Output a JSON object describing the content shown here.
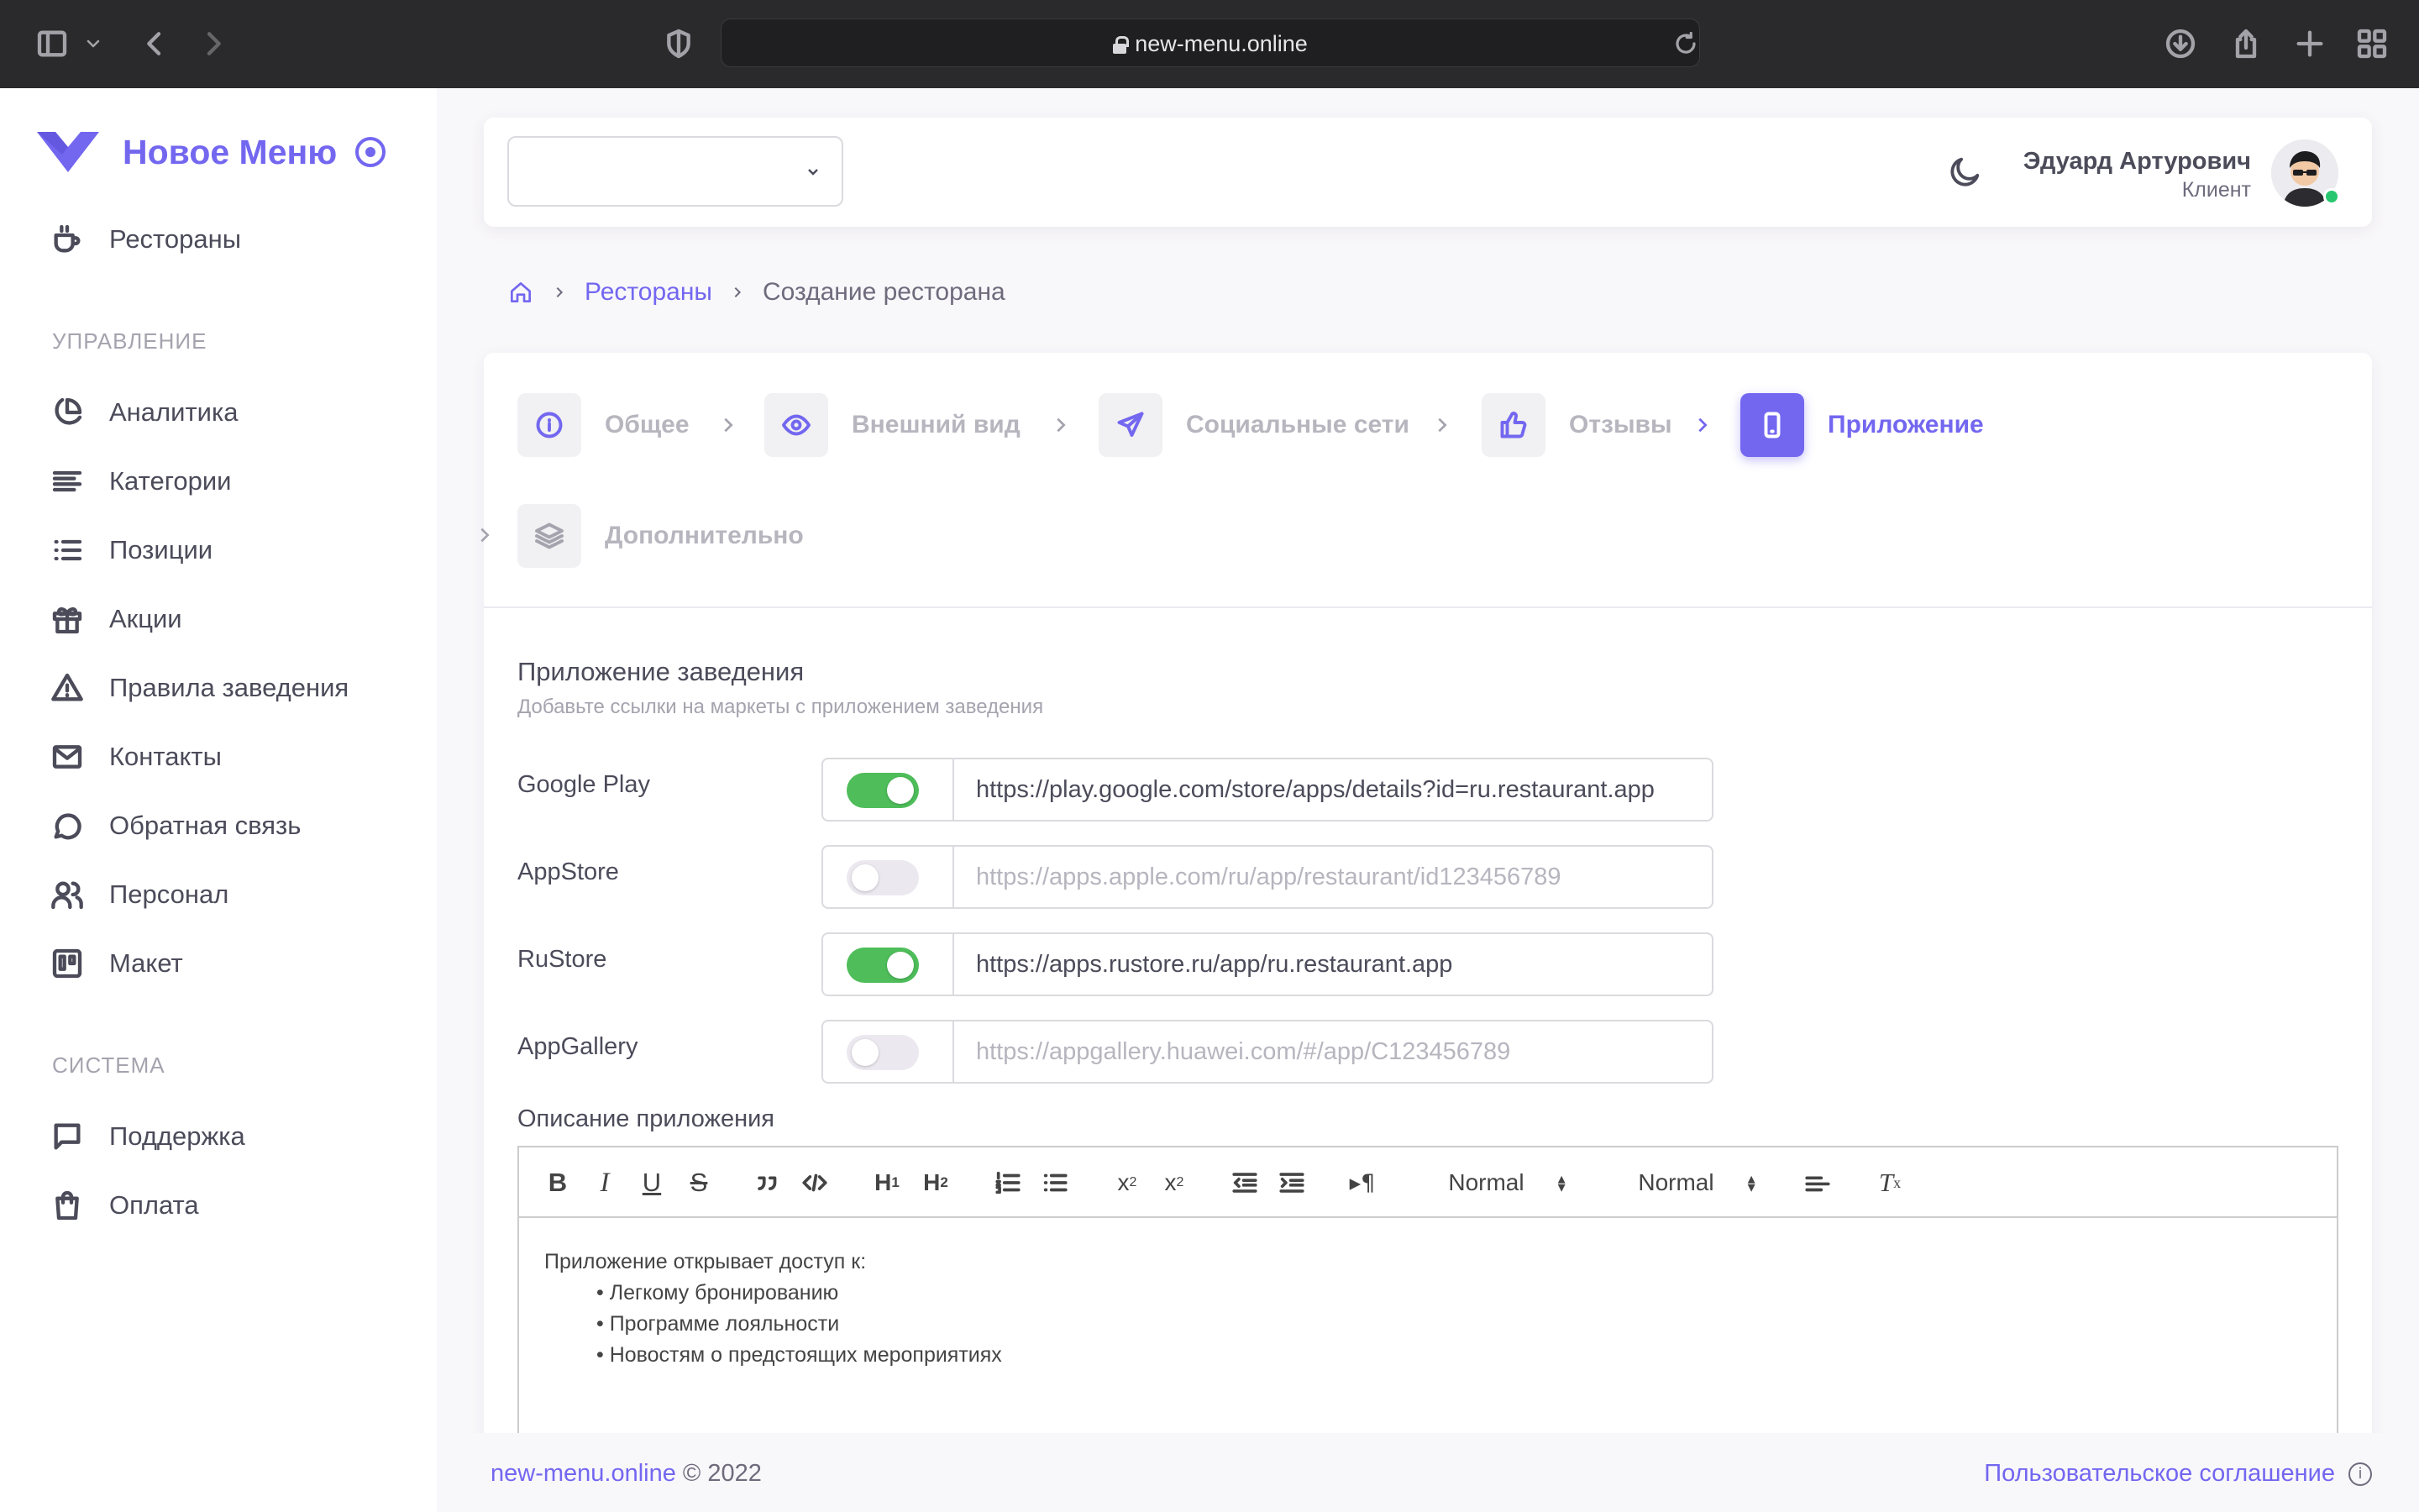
{
  "browser": {
    "url": "new-menu.online"
  },
  "sidebar": {
    "brand": "Новое Меню",
    "top_items": [
      {
        "label": "Рестораны",
        "icon": "coffee-cup-icon"
      }
    ],
    "sections": [
      {
        "title": "УПРАВЛЕНИЕ",
        "items": [
          {
            "label": "Аналитика",
            "icon": "pie-chart-icon"
          },
          {
            "label": "Категории",
            "icon": "align-left-icon"
          },
          {
            "label": "Позиции",
            "icon": "list-icon"
          },
          {
            "label": "Акции",
            "icon": "gift-icon"
          },
          {
            "label": "Правила заведения",
            "icon": "alert-triangle-icon"
          },
          {
            "label": "Контакты",
            "icon": "mail-icon"
          },
          {
            "label": "Обратная связь",
            "icon": "message-circle-icon"
          },
          {
            "label": "Персонал",
            "icon": "users-icon"
          },
          {
            "label": "Макет",
            "icon": "layout-board-icon"
          }
        ]
      },
      {
        "title": "СИСТЕМА",
        "items": [
          {
            "label": "Поддержка",
            "icon": "message-square-icon"
          },
          {
            "label": "Оплата",
            "icon": "shopping-bag-icon"
          }
        ]
      }
    ]
  },
  "header": {
    "select_value": "",
    "user_name": "Эдуард Артурович",
    "user_role": "Клиент"
  },
  "breadcrumb": {
    "link": "Рестораны",
    "current": "Создание ресторана"
  },
  "wizard": {
    "steps": [
      {
        "label": "Общее",
        "icon": "info-icon",
        "state": "done"
      },
      {
        "label": "Внешний вид",
        "icon": "eye-icon",
        "state": "done"
      },
      {
        "label": "Социальные сети",
        "icon": "send-icon",
        "state": "done"
      },
      {
        "label": "Отзывы",
        "icon": "thumbs-up-icon",
        "state": "done"
      },
      {
        "label": "Приложение",
        "icon": "smartphone-icon",
        "state": "active"
      },
      {
        "label": "Дополнительно",
        "icon": "layers-icon",
        "state": "disabled"
      }
    ]
  },
  "app_section": {
    "title": "Приложение заведения",
    "subtitle": "Добавьте ссылки на маркеты с приложением заведения",
    "stores": [
      {
        "label": "Google Play",
        "enabled": true,
        "value": "https://play.google.com/store/apps/details?id=ru.restaurant.app",
        "placeholder": ""
      },
      {
        "label": "AppStore",
        "enabled": false,
        "value": "",
        "placeholder": "https://apps.apple.com/ru/app/restaurant/id123456789"
      },
      {
        "label": "RuStore",
        "enabled": true,
        "value": "https://apps.rustore.ru/app/ru.restaurant.app",
        "placeholder": ""
      },
      {
        "label": "AppGallery",
        "enabled": false,
        "value": "",
        "placeholder": "https://appgallery.huawei.com/#/app/C123456789"
      }
    ],
    "description_label": "Описание приложения",
    "toolbar": {
      "header_select": "Normal",
      "size_select": "Normal"
    },
    "description_text": {
      "intro": "Приложение открывает доступ к:",
      "bullets": [
        "• Легкому бронированию",
        "• Программе лояльности",
        "• Новостям о предстоящих мероприятиях"
      ]
    }
  },
  "footer": {
    "site": "new-menu.online",
    "copyright": "© 2022",
    "agreement": "Пользовательское соглашение"
  },
  "colors": {
    "primary": "#7367f0",
    "toggle_on": "#4ebd5a",
    "online": "#28c76f"
  }
}
